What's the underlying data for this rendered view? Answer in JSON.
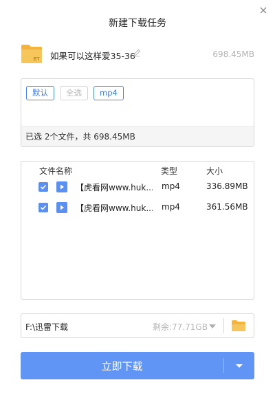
{
  "dialog": {
    "title": "新建下载任务"
  },
  "task": {
    "icon_label": "BT",
    "name": "如果可以这样爱35-36",
    "size": "698.45MB"
  },
  "filters": {
    "default_label": "默认",
    "select_all_label": "全选",
    "mp4_label": "mp4",
    "summary": "已选 2个文件，共 698.45MB"
  },
  "file_list": {
    "headers": {
      "name": "文件名称",
      "type": "类型",
      "size": "大小"
    },
    "rows": [
      {
        "checked": true,
        "name": "【虎看网www.huk...",
        "type": "mp4",
        "size": "336.89MB"
      },
      {
        "checked": true,
        "name": "【虎看网www.huk...",
        "type": "mp4",
        "size": "361.56MB"
      }
    ]
  },
  "save_path": {
    "path": "F:\\迅雷下载",
    "free_space": "剩余:77.71GB"
  },
  "actions": {
    "download_label": "立即下载"
  },
  "colors": {
    "accent": "#6195f5",
    "tag_border": "#4a83f0",
    "folder": "#f7c65a"
  },
  "icons": {
    "close": "close-icon",
    "bt_file": "bt-file-icon",
    "edit": "edit-icon",
    "checkbox": "checkbox-checked-icon",
    "video": "video-file-icon",
    "dropdown": "chevron-down-icon",
    "folder": "folder-icon"
  }
}
